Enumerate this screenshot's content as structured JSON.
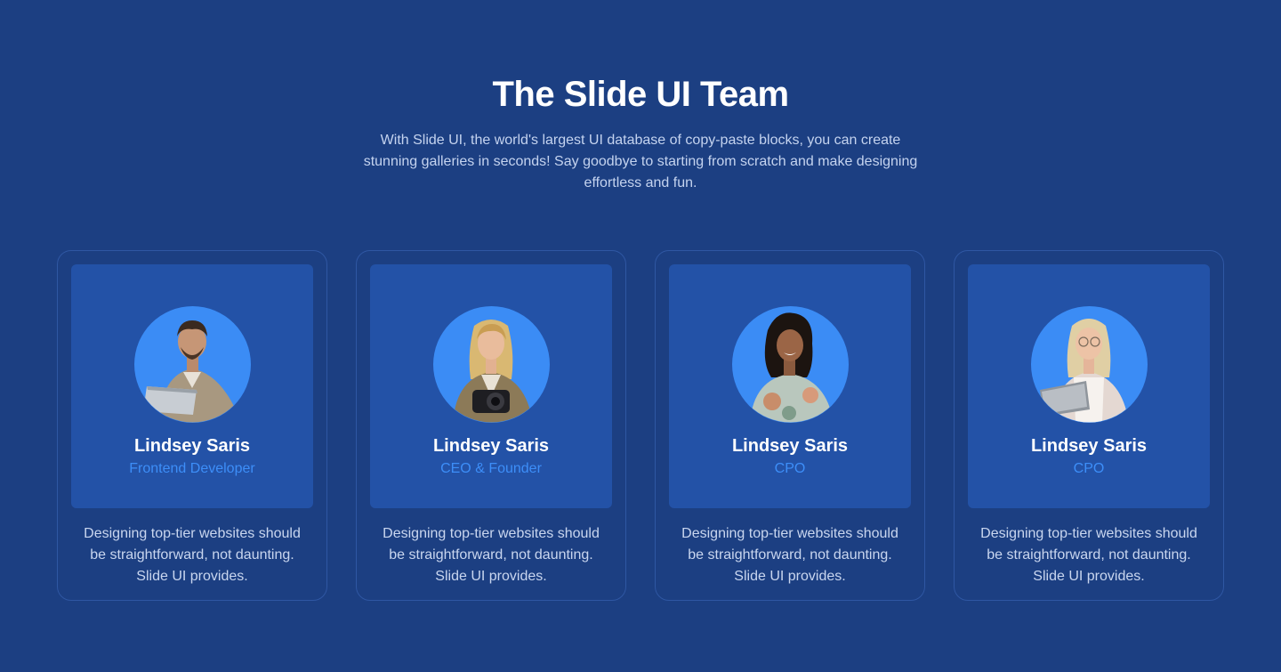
{
  "section": {
    "title": "The Slide UI Team",
    "subtitle": "With Slide UI, the world's largest UI database of copy-paste blocks, you can create stunning galleries in seconds! Say goodbye to starting from scratch and make designing effortless and fun."
  },
  "team": [
    {
      "name": "Lindsey Saris",
      "role": "Frontend Developer",
      "description": "Designing top-tier websites should be straightforward, not daunting. Slide UI provides.",
      "photo": "man-with-laptop"
    },
    {
      "name": "Lindsey Saris",
      "role": "CEO & Founder",
      "description": "Designing top-tier websites should be straightforward, not daunting. Slide UI provides.",
      "photo": "woman-with-camera"
    },
    {
      "name": "Lindsey Saris",
      "role": "CPO",
      "description": "Designing top-tier websites should be straightforward, not daunting. Slide UI provides.",
      "photo": "woman-floral-shirt"
    },
    {
      "name": "Lindsey Saris",
      "role": "CPO",
      "description": "Designing top-tier websites should be straightforward, not daunting. Slide UI provides.",
      "photo": "woman-with-tablet"
    }
  ],
  "colors": {
    "background": "#1c3f82",
    "card_inner": "#2352a7",
    "avatar_bg": "#3b8cf5",
    "role_text": "#3d8ef8"
  }
}
